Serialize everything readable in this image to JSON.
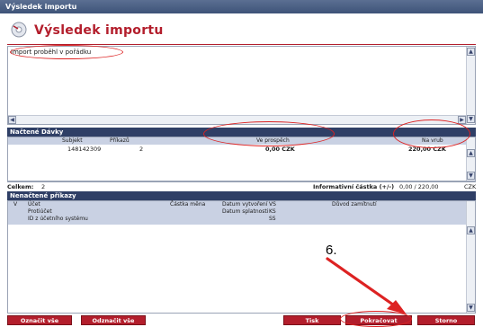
{
  "window": {
    "title": "Výsledek importu"
  },
  "header": {
    "title": "Výsledek importu",
    "icon": "disk-icon"
  },
  "message": {
    "text": "Import proběhl v pořádku"
  },
  "loaded": {
    "section_title": "Načtené Dávky",
    "columns": {
      "subject": "Subjekt",
      "orders": "Příkazů",
      "credit": "Ve prospěch",
      "debit": "Na vrub"
    },
    "rows": [
      {
        "subject": "148142309",
        "orders": "2",
        "credit": "0,00 CZK",
        "debit": "220,00 CZK"
      }
    ]
  },
  "totals": {
    "label": "Celkem:",
    "count": "2",
    "info_label": "Informativní částka (+/-)",
    "info_value": "0,00 / 220,00",
    "currency": "CZK"
  },
  "unloaded": {
    "section_title": "Nenačtené příkazy",
    "columns": {
      "v": "V",
      "account": "Účet",
      "counter_account": "Protiúčet",
      "system_id": "ID z účetního systému",
      "amount_currency": "Částka měna",
      "date_created": "Datum vytvoření",
      "date_due": "Datum splatnosti",
      "vs": "VS",
      "ks": "KS",
      "ss": "SS",
      "reject_reason": "Důvod zamítnutí"
    }
  },
  "buttons": {
    "mark_all": "Označit vše",
    "unmark_all": "Odznačit vše",
    "print": "Tisk",
    "continue": "Pokračovat",
    "cancel": "Storno"
  },
  "annotation": {
    "step_label": "6."
  },
  "colors": {
    "accent": "#b31e2c",
    "section_bar": "#2f3f66",
    "marker": "#dd2222"
  }
}
